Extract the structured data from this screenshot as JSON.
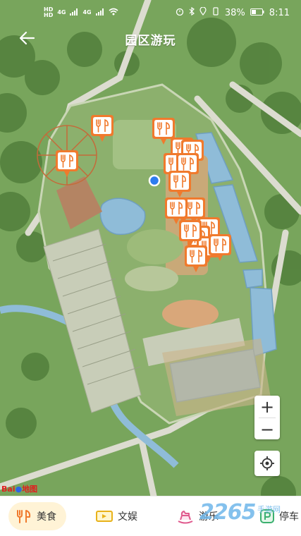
{
  "status": {
    "sim1": "HD",
    "sim1_net": "4G",
    "sim2": "HD",
    "sim2_net": "4G",
    "battery": "38%",
    "time": "8:11"
  },
  "header": {
    "title": "园区游玩"
  },
  "map": {
    "marker_count": 17,
    "pois": [
      {
        "icon": "restaurant-icon"
      },
      {
        "icon": "restaurant-icon"
      },
      {
        "icon": "restaurant-icon"
      }
    ],
    "attribution_brand": "Bai",
    "attribution_map": "地图"
  },
  "tabs": [
    {
      "label": "美食",
      "icon": "restaurant-icon",
      "active": true
    },
    {
      "label": "文娱",
      "icon": "ticket-icon",
      "active": false
    },
    {
      "label": "游乐",
      "icon": "rocking-horse-icon",
      "active": false
    },
    {
      "label": "停车",
      "icon": "parking-icon",
      "active": false
    }
  ],
  "watermark": {
    "brand": "2265",
    "sub": "手游网"
  },
  "colors": {
    "accent": "#f07a2d",
    "marker_fill": "#ffffff",
    "lake": "#8fbcd8"
  }
}
